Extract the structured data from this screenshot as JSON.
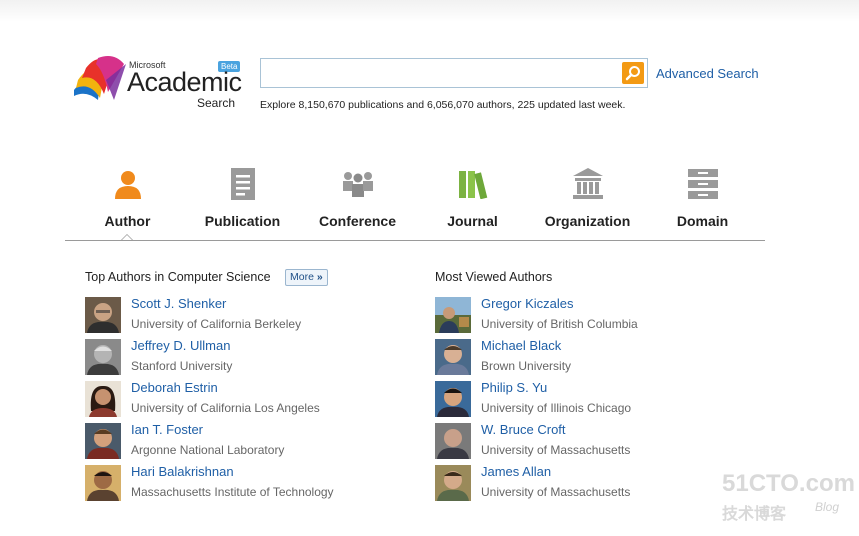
{
  "logo": {
    "brand": "Microsoft",
    "name": "Academic",
    "sub": "Search",
    "badge": "Beta"
  },
  "search": {
    "value": "",
    "placeholder": "",
    "advanced_label": "Advanced Search",
    "stats": "Explore 8,150,670 publications and 6,056,070 authors, 225 updated last week."
  },
  "tabs": [
    {
      "label": "Author",
      "icon": "person-icon",
      "active": true
    },
    {
      "label": "Publication",
      "icon": "document-icon",
      "active": false
    },
    {
      "label": "Conference",
      "icon": "group-icon",
      "active": false
    },
    {
      "label": "Journal",
      "icon": "books-icon",
      "active": false
    },
    {
      "label": "Organization",
      "icon": "building-icon",
      "active": false
    },
    {
      "label": "Domain",
      "icon": "stack-icon",
      "active": false
    }
  ],
  "top_authors": {
    "title": "Top Authors in Computer Science",
    "more_label": "More",
    "items": [
      {
        "name": "Scott J. Shenker",
        "institution": "University of California Berkeley"
      },
      {
        "name": "Jeffrey D. Ullman",
        "institution": "Stanford University"
      },
      {
        "name": "Deborah Estrin",
        "institution": "University of California Los Angeles"
      },
      {
        "name": "Ian T. Foster",
        "institution": "Argonne National Laboratory"
      },
      {
        "name": "Hari Balakrishnan",
        "institution": "Massachusetts Institute of Technology"
      }
    ]
  },
  "most_viewed": {
    "title": "Most Viewed Authors",
    "items": [
      {
        "name": "Gregor Kiczales",
        "institution": "University of British Columbia"
      },
      {
        "name": "Michael Black",
        "institution": "Brown University"
      },
      {
        "name": "Philip S. Yu",
        "institution": "University of Illinois Chicago"
      },
      {
        "name": "W. Bruce Croft",
        "institution": "University of Massachusetts"
      },
      {
        "name": "James Allan",
        "institution": "University of Massachusetts"
      }
    ]
  },
  "watermark": {
    "site": "51CTO.com",
    "cn": "技术博客",
    "blog": "Blog"
  },
  "colors": {
    "link": "#1f5fa6",
    "accent_orange": "#f39a14",
    "active_icon": "#f08a1c",
    "inactive_icon": "#9a9a9a",
    "journal_icon": "#7cb342"
  }
}
